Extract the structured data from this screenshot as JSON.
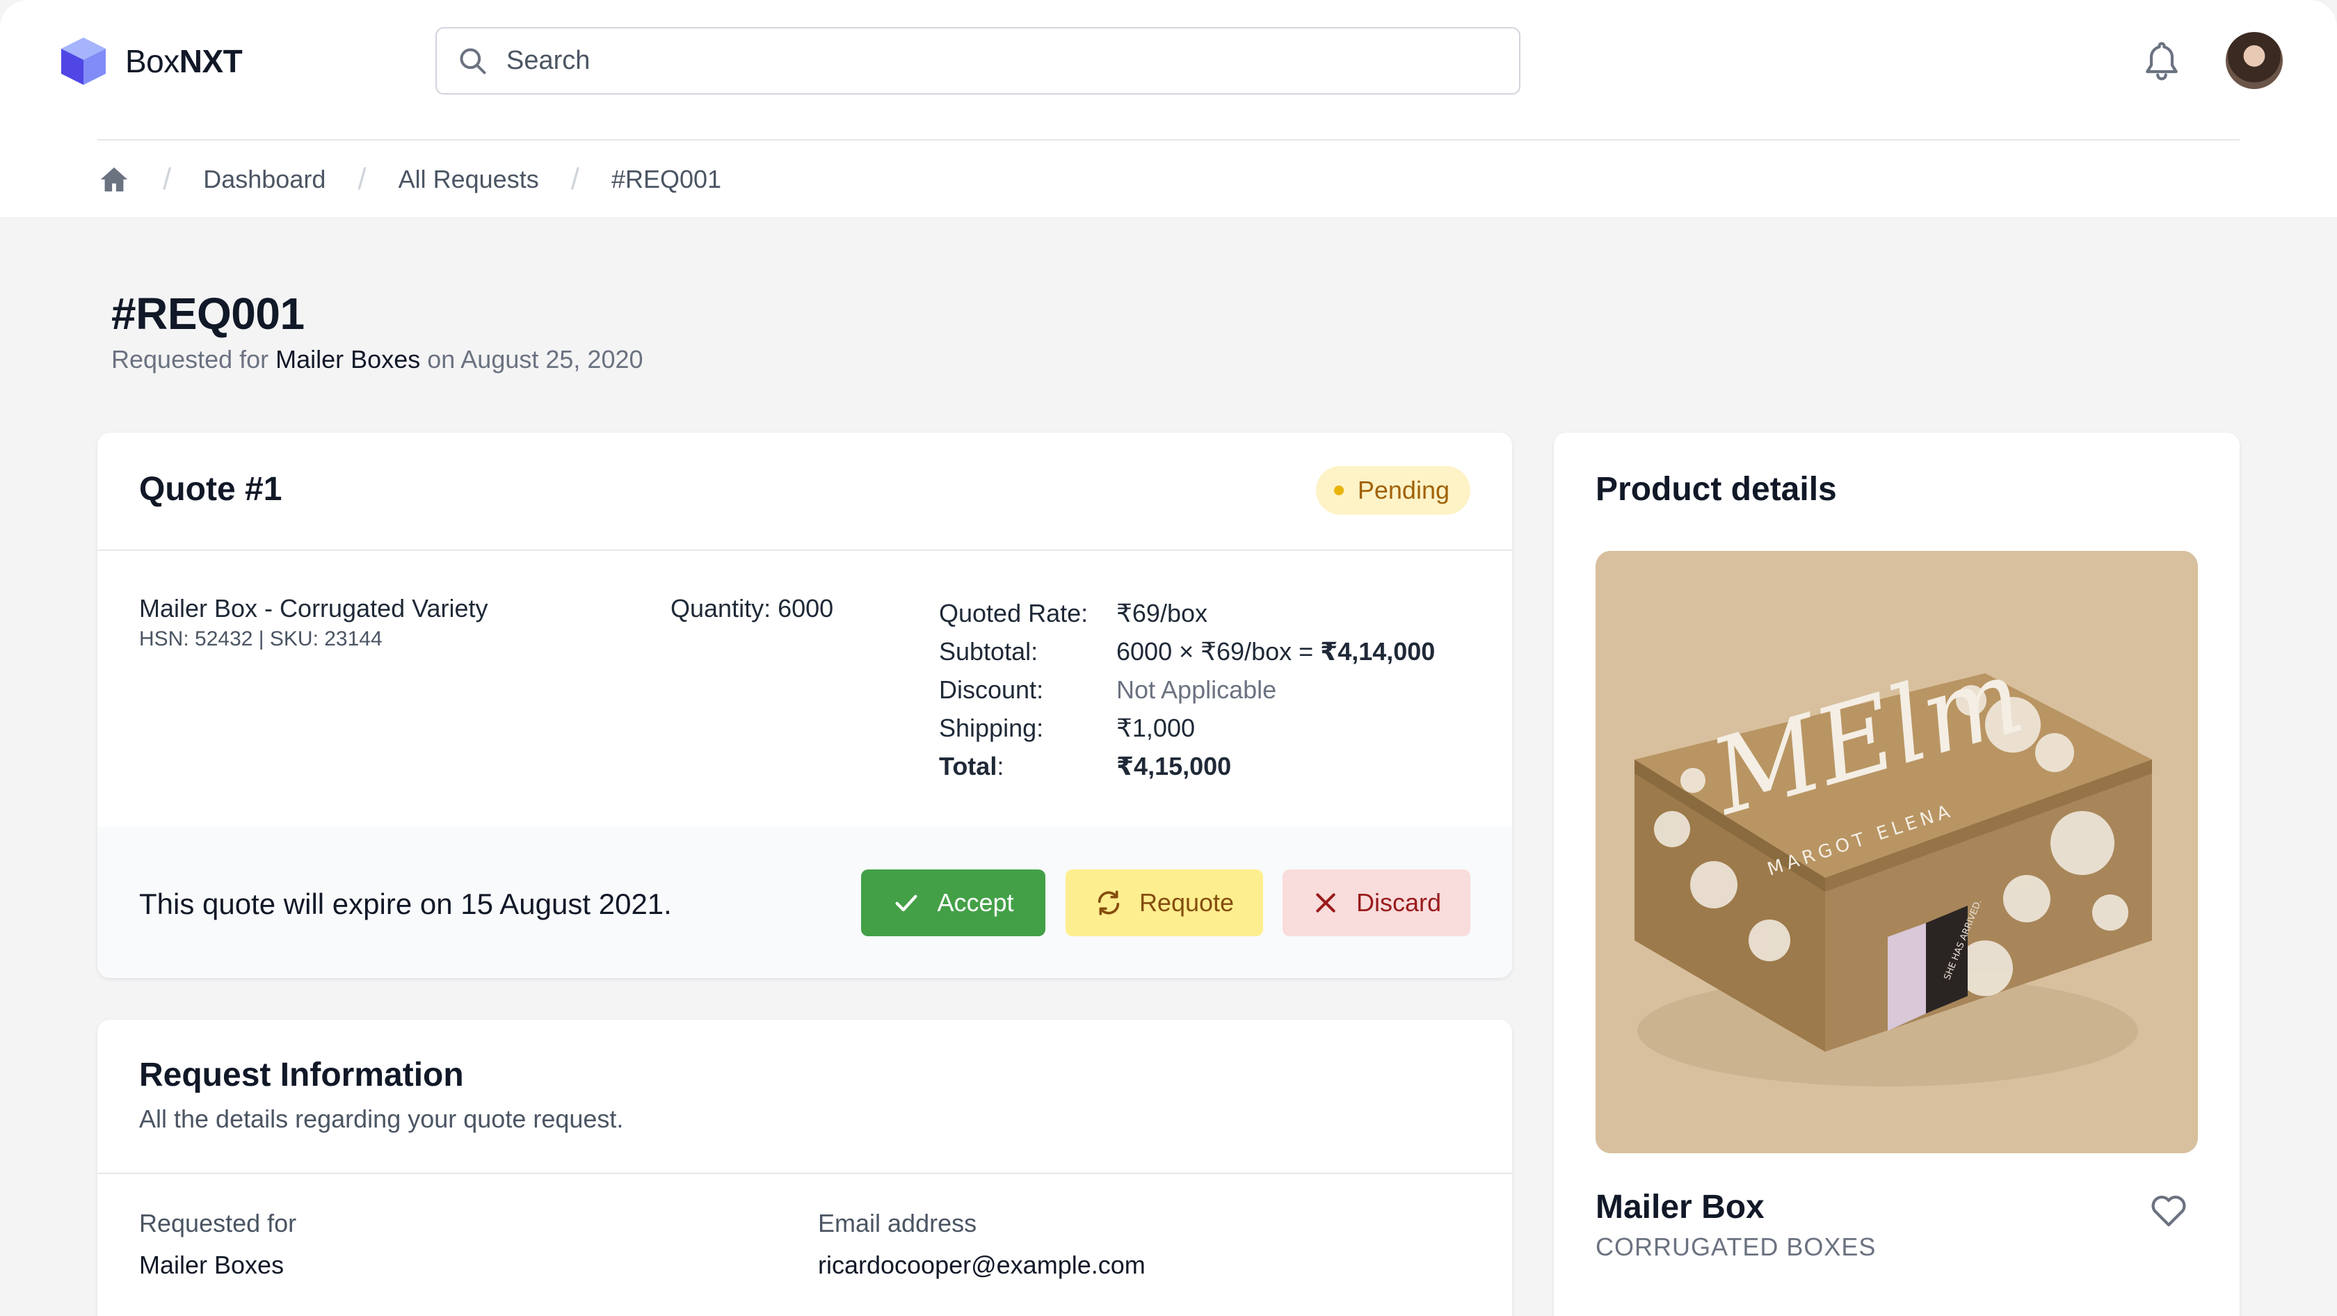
{
  "app": {
    "brand_regular": "Box",
    "brand_bold": "NXT"
  },
  "search": {
    "placeholder": "Search"
  },
  "breadcrumb": {
    "items": [
      "Dashboard",
      "All Requests",
      "#REQ001"
    ]
  },
  "page": {
    "title": "#REQ001",
    "subtitle_prefix": "Requested for ",
    "subtitle_product": "Mailer Boxes",
    "subtitle_suffix": " on August 25, 2020"
  },
  "quote": {
    "title": "Quote #1",
    "status": "Pending",
    "product_name": "Mailer Box - Corrugated Variety",
    "product_meta": "HSN: 52432 | SKU: 23144",
    "quantity": "Quantity: 6000",
    "pricing": {
      "rate_label": "Quoted Rate:",
      "rate_value": "₹69/box",
      "subtotal_label": "Subtotal:",
      "subtotal_calc": "6000 × ₹69/box = ",
      "subtotal_value": "₹4,14,000",
      "discount_label": "Discount:",
      "discount_value": "Not Applicable",
      "shipping_label": "Shipping:",
      "shipping_value": "₹1,000",
      "total_label": "Total",
      "total_colon": ":",
      "total_value": "₹4,15,000"
    },
    "expiry_text": "This quote will expire on 15 August 2021.",
    "actions": {
      "accept": "Accept",
      "requote": "Requote",
      "discard": "Discard"
    }
  },
  "request_info": {
    "title": "Request Information",
    "subtitle": "All the details regarding your quote request.",
    "fields": [
      {
        "label": "Requested for",
        "value": "Mailer Boxes"
      },
      {
        "label": "Email address",
        "value": "ricardocooper@example.com"
      }
    ]
  },
  "product_details": {
    "title": "Product details",
    "name": "Mailer Box",
    "category": "CORRUGATED BOXES",
    "image_text": {
      "script": "MElm",
      "brand": "MARGOT ELENA",
      "tag": "SHE HAS ARRIVED."
    }
  },
  "colors": {
    "accept": "#43a047",
    "requote": "#fdee8f",
    "discard": "#f9dcdc",
    "pending_bg": "#fef3c7",
    "pending_dot": "#eab308",
    "logo": "#6366f1"
  }
}
